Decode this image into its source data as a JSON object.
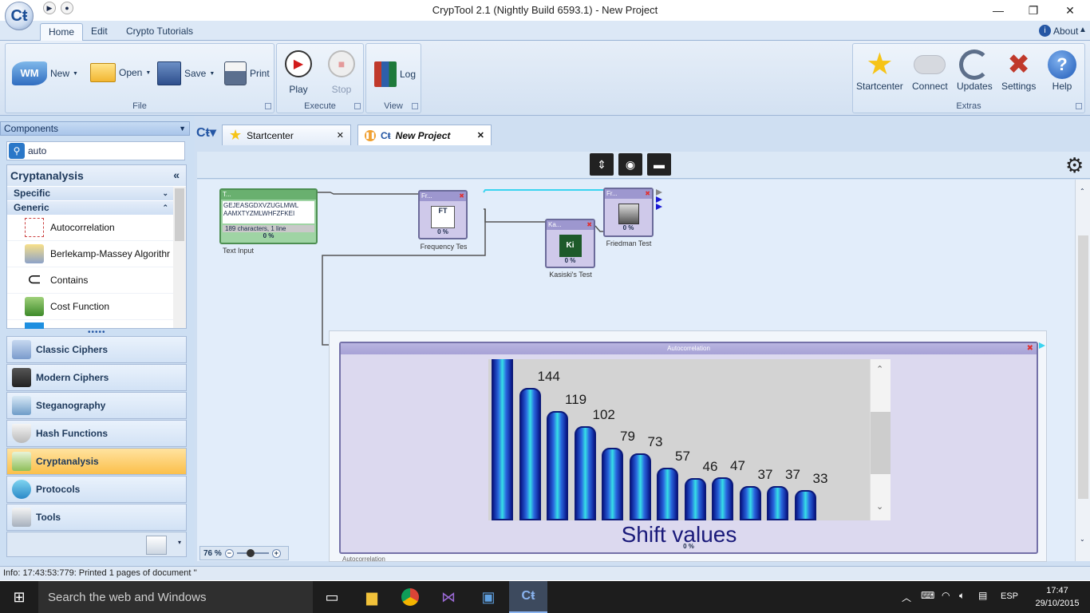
{
  "window": {
    "title": "CrypTool 2.1 (Nightly Build 6593.1) - New Project",
    "minimize": "—",
    "restore": "❐",
    "close": "✕"
  },
  "ribbon": {
    "tabs": [
      "Home",
      "Edit",
      "Crypto Tutorials"
    ],
    "about": "About",
    "groups": {
      "file": "File",
      "execute": "Execute",
      "view": "View",
      "extras": "Extras"
    },
    "buttons": {
      "new": "New",
      "open": "Open",
      "save": "Save",
      "print": "Print",
      "play": "Play",
      "stop": "Stop",
      "log": "Log",
      "startcenter": "Startcenter",
      "connect": "Connect",
      "updates": "Updates",
      "settings": "Settings",
      "help": "Help"
    }
  },
  "components": {
    "header": "Components",
    "search_value": "auto",
    "category_title": "Cryptanalysis",
    "subcategories": [
      "Specific",
      "Generic"
    ],
    "items": [
      "Autocorrelation",
      "Berlekamp-Massey Algorithr",
      "Contains",
      "Cost Function"
    ],
    "nav": [
      "Classic Ciphers",
      "Modern Ciphers",
      "Steganography",
      "Hash Functions",
      "Cryptanalysis",
      "Protocols",
      "Tools"
    ]
  },
  "workspace": {
    "tabs": [
      "Startcenter",
      "New Project"
    ],
    "zoom": "76 %"
  },
  "plugins": {
    "text_input": {
      "label": "Text Input",
      "text_line1": "GEJEASGDXVZUGLMWL",
      "text_line2": "AAMXTYZMLWHFZFKEI",
      "info": "189 characters,  1 line",
      "progress": "0 %",
      "head": "T..."
    },
    "frequency": {
      "label": "Frequency Tes",
      "progress": "0 %",
      "head": "Fr..."
    },
    "kasiski": {
      "label": "Kasiski's Test",
      "progress": "0 %",
      "head": "Ka..."
    },
    "friedman": {
      "label": "Friedman Test",
      "progress": "0 %",
      "head": "Fr..."
    },
    "autocorrelation": {
      "head": "Autocorrelation",
      "progress": "0 %",
      "footer": "Autocorrelation"
    }
  },
  "chart_data": {
    "type": "bar",
    "xlabel": "Shift values",
    "values": [
      null,
      144,
      119,
      102,
      79,
      73,
      57,
      46,
      47,
      37,
      37,
      33
    ],
    "labels": [
      "",
      "144",
      "119",
      "102",
      "79",
      "73",
      "57",
      "46",
      "47",
      "37",
      "37",
      "33"
    ],
    "note_first_bar_clipped": true
  },
  "status": {
    "text": "Info: 17:43:53:779: Printed 1 pages of document ''"
  },
  "taskbar": {
    "search_placeholder": "Search the web and Windows",
    "lang": "ESP",
    "time": "17:47",
    "date": "29/10/2015"
  }
}
